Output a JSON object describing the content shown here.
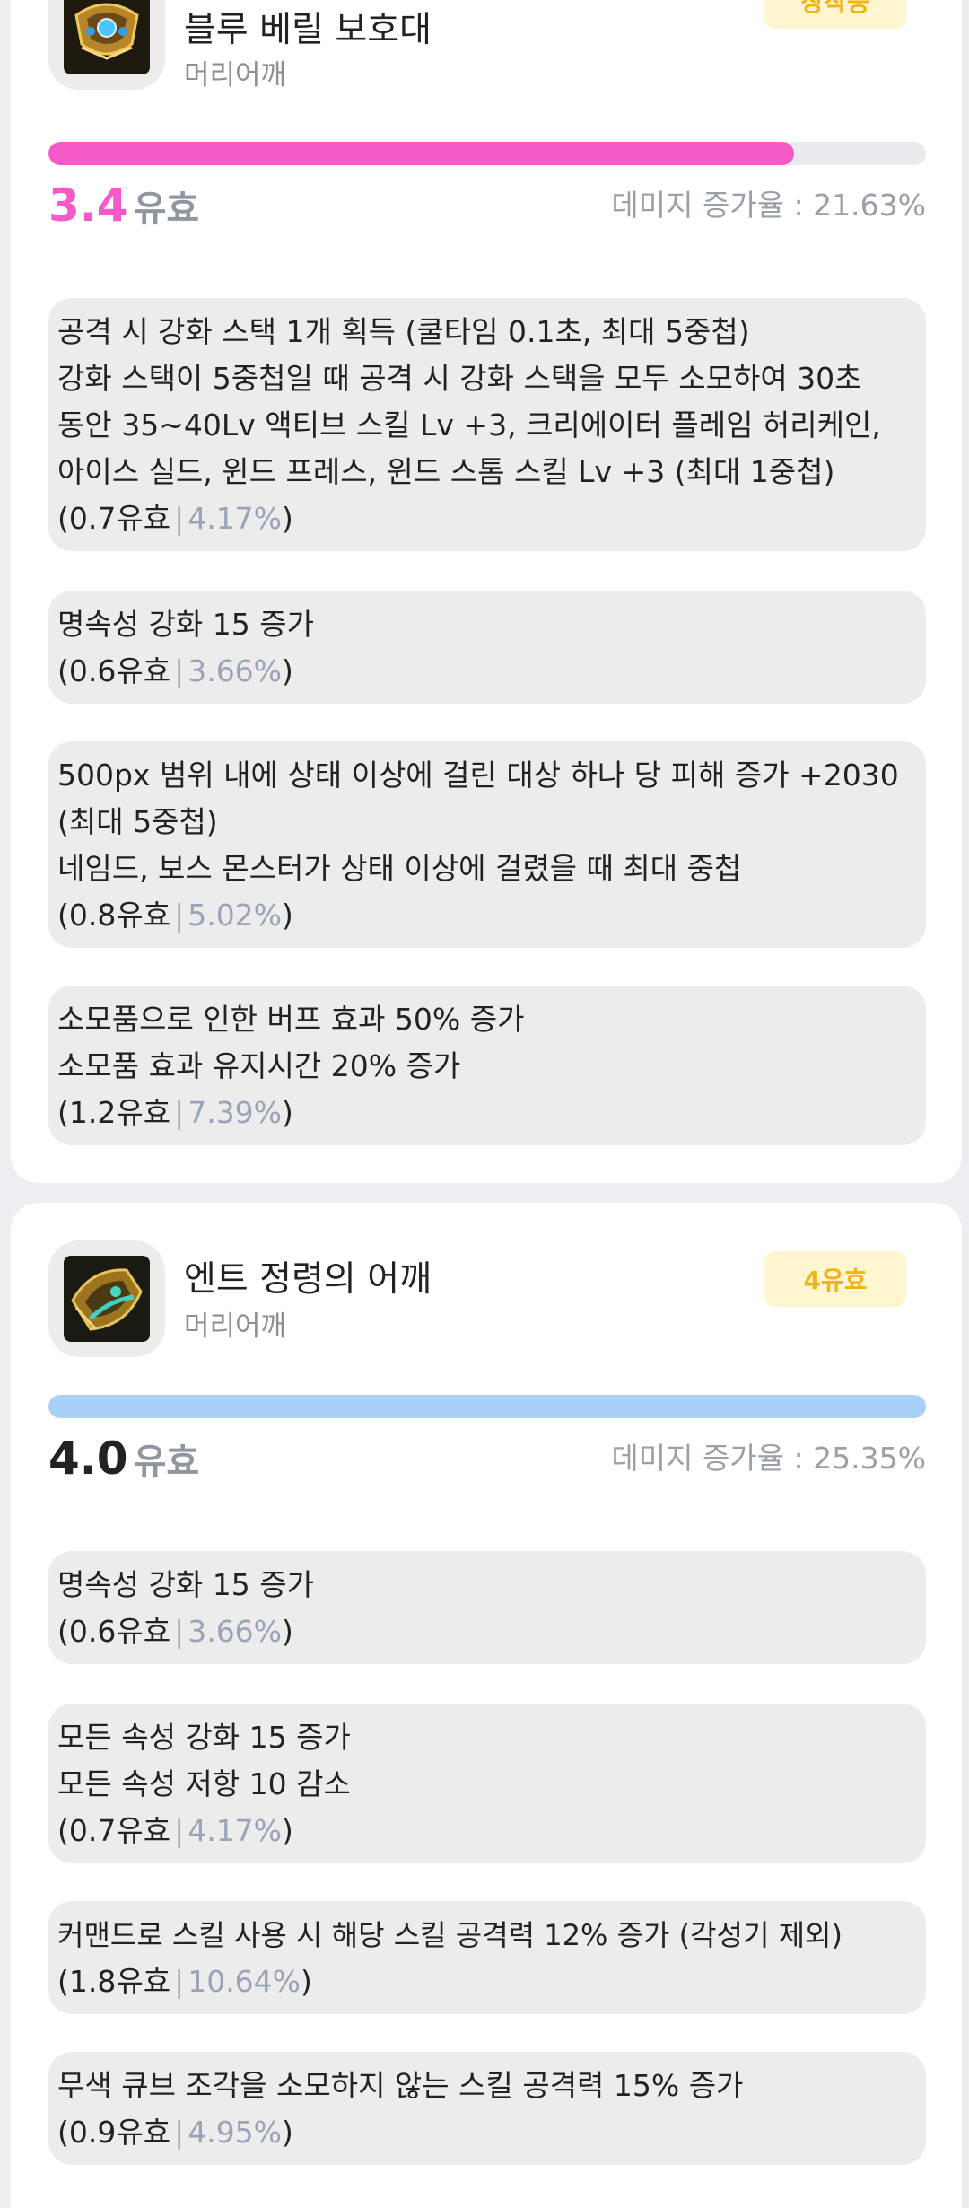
{
  "items": [
    {
      "title": "블루 베릴 보호대",
      "slot": "머리어깨",
      "badge": "장착중",
      "bar_percent": 85,
      "bar_color": "#f45bc8",
      "score": "3.4",
      "score_color": "#f45bc8",
      "score_unit": "유효",
      "damage_text": "데미지 증가율 : 21.63%",
      "options": [
        {
          "lines": [
            "공격 시 강화 스택 1개 획득 (쿨타임 0.1초, 최대 5중첩)",
            "강화 스택이 5중첩일 때 공격 시 강화 스택을 모두 소모하여 30초",
            "동안 35~40Lv 액티브 스킬 Lv +3, 크리에이터 플레임 허리케인,",
            "아이스 실드, 윈드 프레스, 윈드 스톰 스킬 Lv +3 (최대 1중첩)"
          ],
          "value": "0.7유효",
          "pct": "4.17%"
        },
        {
          "lines": [
            "명속성 강화 15 증가"
          ],
          "value": "0.6유효",
          "pct": "3.66%"
        },
        {
          "lines": [
            "500px 범위 내에 상태 이상에 걸린 대상 하나 당 피해 증가 +2030",
            "(최대 5중첩)",
            "네임드, 보스 몬스터가 상태 이상에 걸렸을 때 최대 중첩"
          ],
          "value": "0.8유효",
          "pct": "5.02%"
        },
        {
          "lines": [
            "소모품으로 인한 버프 효과 50% 증가",
            "소모품 효과 유지시간 20% 증가"
          ],
          "value": "1.2유효",
          "pct": "7.39%"
        }
      ]
    },
    {
      "title": "엔트 정령의 어깨",
      "slot": "머리어깨",
      "badge": "4유효",
      "bar_percent": 100,
      "bar_color": "#a9d1f7",
      "score": "4.0",
      "score_color": "#222222",
      "score_unit": "유효",
      "damage_text": "데미지 증가율 : 25.35%",
      "options": [
        {
          "lines": [
            "명속성 강화 15 증가"
          ],
          "value": "0.6유효",
          "pct": "3.66%"
        },
        {
          "lines": [
            "모든 속성 강화 15 증가",
            "모든 속성 저항 10 감소"
          ],
          "value": "0.7유효",
          "pct": "4.17%"
        },
        {
          "lines": [
            "커맨드로 스킬 사용 시 해당 스킬 공격력 12% 증가 (각성기 제외)"
          ],
          "value": "1.8유효",
          "pct": "10.64%"
        },
        {
          "lines": [
            "무색 큐브 조각을 소모하지 않는 스킬 공격력 15% 증가"
          ],
          "value": "0.9유효",
          "pct": "4.95%"
        }
      ]
    }
  ]
}
